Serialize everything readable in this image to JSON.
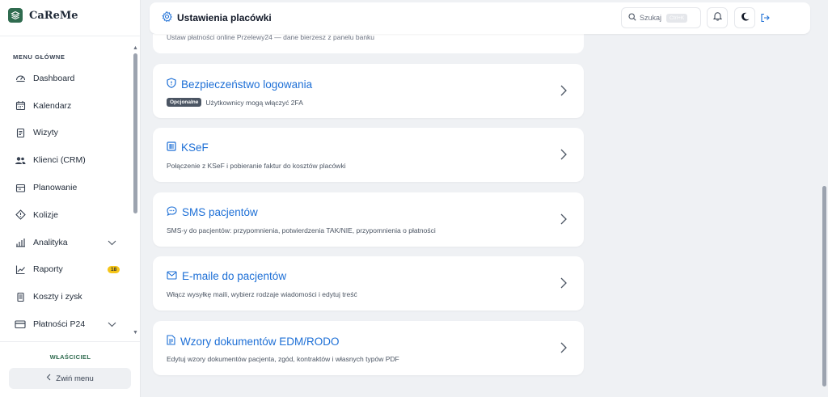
{
  "app": {
    "name": "CaReMe"
  },
  "sidebar": {
    "section_label": "MENU GŁÓWNE",
    "items": [
      {
        "label": "Dashboard",
        "icon": "gauge-icon"
      },
      {
        "label": "Kalendarz",
        "icon": "calendar-icon"
      },
      {
        "label": "Wizyty",
        "icon": "document-icon"
      },
      {
        "label": "Klienci (CRM)",
        "icon": "users-icon"
      },
      {
        "label": "Planowanie",
        "icon": "planner-icon"
      },
      {
        "label": "Kolizje",
        "icon": "warning-diamond-icon"
      },
      {
        "label": "Analityka",
        "icon": "bar-chart-icon"
      },
      {
        "label": "Raporty",
        "icon": "trend-chart-icon",
        "badge": "18"
      },
      {
        "label": "Koszty i zysk",
        "icon": "receipt-icon"
      },
      {
        "label": "Płatności P24",
        "icon": "credit-card-icon"
      }
    ],
    "role": "WŁAŚCICIEL",
    "collapse_label": "Zwiń menu"
  },
  "header": {
    "title": "Ustawienia placówki",
    "search_label": "Szukaj",
    "search_shortcut": "Ctrl+K"
  },
  "partial_card": {
    "description": "Ustaw płatności online Przelewy24 — dane bierzesz z panelu banku"
  },
  "cards": [
    {
      "title": "Bezpieczeństwo logowania",
      "badge": "Opcjonalne",
      "description": "Użytkownicy mogą włączyć 2FA",
      "icon": "shield-icon"
    },
    {
      "title": "KSeF",
      "description": "Połączenie z KSeF i pobieranie faktur do kosztów placówki",
      "icon": "invoice-icon"
    },
    {
      "title": "SMS pacjentów",
      "description": "SMS-y do pacjentów: przypomnienia, potwierdzenia TAK/NIE, przypomnienia o płatności",
      "icon": "chat-icon"
    },
    {
      "title": "E-maile do pacjentów",
      "description": "Włącz wysyłkę maili, wybierz rodzaje wiadomości i edytuj treść",
      "icon": "mail-icon"
    },
    {
      "title": "Wzory dokumentów EDM/RODO",
      "description": "Edytuj wzory dokumentów pacjenta, zgód, kontraktów i własnych typów PDF",
      "icon": "file-text-icon"
    }
  ],
  "colors": {
    "brand": "#2f6b4f",
    "accent": "#1d6fd6",
    "badge": "#f5c518"
  }
}
